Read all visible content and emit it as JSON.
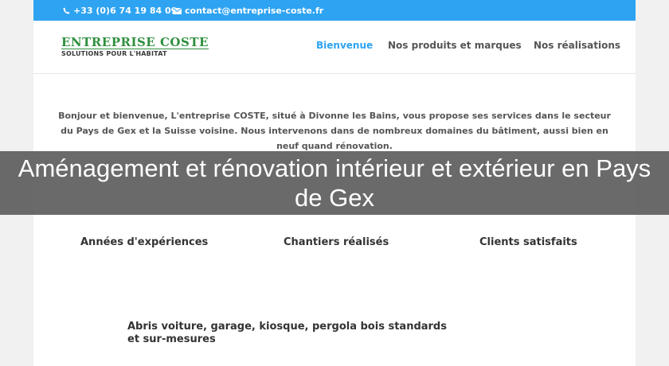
{
  "topbar": {
    "phone": "+33 (0)6 74 19 84 09",
    "email": "contact@entreprise-coste.fr",
    "phone_icon": "phone-icon",
    "email_icon": "envelope-icon",
    "color": "#2ea3f2"
  },
  "logo": {
    "title": "ENTREPRISE COSTE",
    "subtitle": "SOLUTIONS POUR L'HABITAT"
  },
  "nav": {
    "items": [
      {
        "label": "Bienvenue",
        "active": true
      },
      {
        "label": "Nos produits et marques",
        "active": false
      },
      {
        "label": "Nos réalisations",
        "active": false
      }
    ],
    "active_color": "#2ea3f2"
  },
  "intro": {
    "text": "Bonjour et bienvenue, L'entreprise COSTE, situé à Divonne les Bains, vous propose ses services dans le secteur du Pays de Gex et la Suisse voisine. Nous intervenons dans de nombreux domaines du bâtiment, aussi bien en neuf quand rénovation."
  },
  "banner": {
    "title": "Aménagement et rénovation intérieur et extérieur en Pays de Gex"
  },
  "stats": [
    {
      "label": "Années d'expériences"
    },
    {
      "label": "Chantiers réalisés"
    },
    {
      "label": "Clients satisfaits"
    }
  ],
  "product": {
    "title": "Abris voiture, garage, kiosque, pergola bois standards et sur-mesures"
  }
}
